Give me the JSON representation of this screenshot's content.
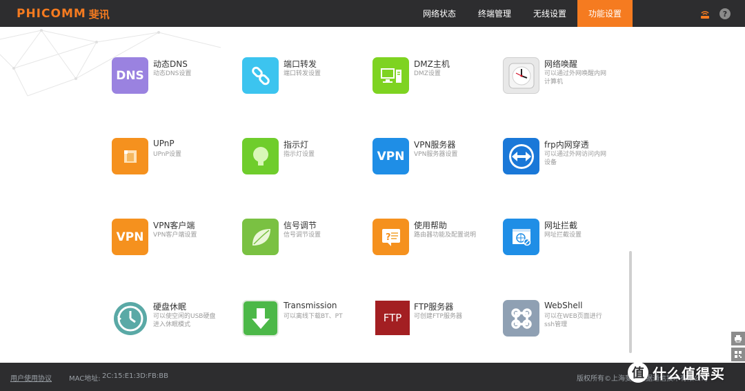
{
  "header": {
    "logo_text": "PHICOMM",
    "logo_cn": "斐讯",
    "nav": [
      {
        "label": "网络状态"
      },
      {
        "label": "终端管理"
      },
      {
        "label": "无线设置"
      },
      {
        "label": "功能设置"
      }
    ],
    "active_nav": "功能设置",
    "help_symbol": "?",
    "accent_color": "#f57b20"
  },
  "tiles": [
    {
      "title": "动态DNS",
      "desc": "动态DNS设置",
      "icon_text": "DNS",
      "icon": "dns-icon",
      "color": "#9a82e0"
    },
    {
      "title": "端口转发",
      "desc": "端口转发设置",
      "icon": "link-icon",
      "color": "#3cc4ef"
    },
    {
      "title": "DMZ主机",
      "desc": "DMZ设置",
      "icon": "computer-icon",
      "color": "#7ed321"
    },
    {
      "title": "网络唤醒",
      "desc": "可以通过外网唤醒内网计算机",
      "icon": "clock-icon",
      "color": "#e8e8e8"
    },
    {
      "title": "UPnP",
      "desc": "UPnP设置",
      "icon": "upnp-icon",
      "color": "#f5911e"
    },
    {
      "title": "指示灯",
      "desc": "指示灯设置",
      "icon": "bulb-icon",
      "color": "#6fcd2c"
    },
    {
      "title": "VPN服务器",
      "desc": "VPN服务器设置",
      "icon_text": "VPN",
      "icon": "vpn-server-icon",
      "color": "#1f8ee6"
    },
    {
      "title": "frp内网穿透",
      "desc": "可以通过外网访问内网设备",
      "icon": "frp-icon",
      "color": "#1a78d8"
    },
    {
      "title": "VPN客户端",
      "desc": "VPN客户端设置",
      "icon_text": "VPN",
      "icon": "vpn-client-icon",
      "color": "#f5911e"
    },
    {
      "title": "信号调节",
      "desc": "信号调节设置",
      "icon": "leaf-icon",
      "color": "#7ac142"
    },
    {
      "title": "使用帮助",
      "desc": "路由器功能及配置说明",
      "icon": "help-doc-icon",
      "color": "#f5911e"
    },
    {
      "title": "网址拦截",
      "desc": "网址拦截设置",
      "icon": "url-block-icon",
      "color": "#1f8ee6"
    },
    {
      "title": "硬盘休眠",
      "desc": "可以使空闲的USB硬盘进入休眠模式",
      "icon": "disk-sleep-icon",
      "color": "#5aa9a6"
    },
    {
      "title": "Transmission",
      "desc": "可以离线下载BT、PT",
      "icon": "download-icon",
      "color": "#4cb848"
    },
    {
      "title": "FTP服务器",
      "desc": "可创建FTP服务器",
      "icon_text": "FTP",
      "icon": "ftp-icon",
      "color": "#a31f22"
    },
    {
      "title": "WebShell",
      "desc": "可以在WEB页面进行ssh管理",
      "icon": "command-icon",
      "color": "#8fa0b3"
    }
  ],
  "footer": {
    "agreement": "用户使用协议",
    "mac_label": "MAC地址:",
    "mac_value": "2C:15:E1:3D:FB:BB",
    "copyright": "版权所有©上海斐讯数据通信技术有限公司"
  },
  "watermark": {
    "badge": "值",
    "text": "什么值得买"
  }
}
